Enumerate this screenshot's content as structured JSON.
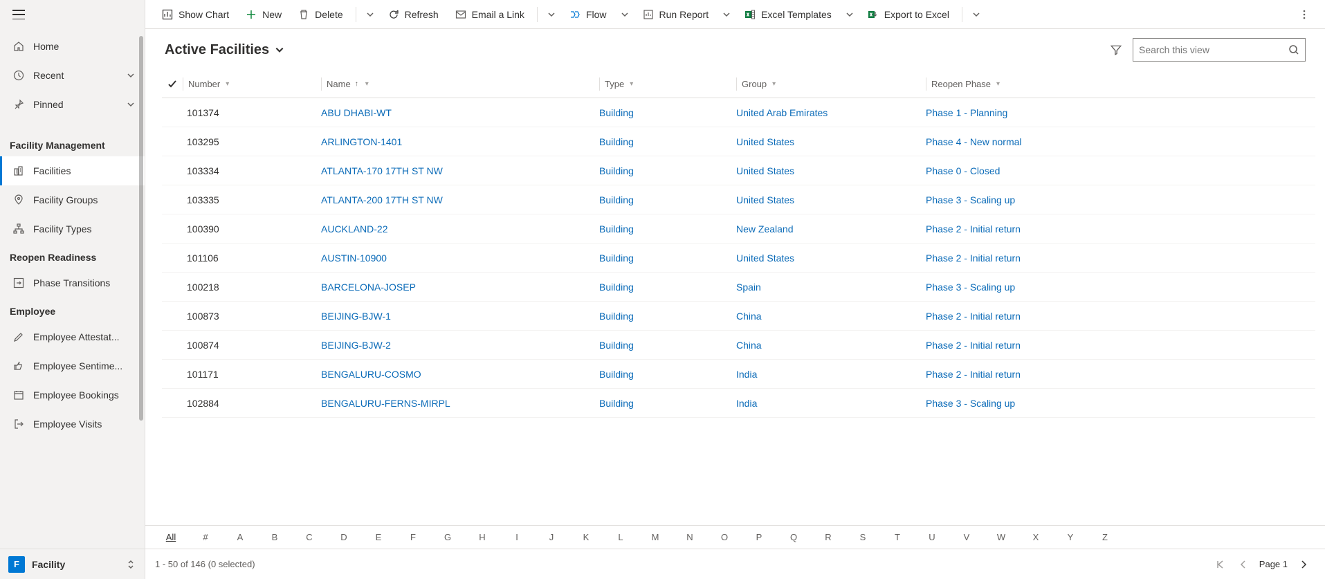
{
  "sidebar": {
    "primary": [
      {
        "label": "Home"
      },
      {
        "label": "Recent"
      },
      {
        "label": "Pinned"
      }
    ],
    "groups": [
      {
        "title": "Facility Management",
        "items": [
          {
            "label": "Facilities",
            "active": true
          },
          {
            "label": "Facility Groups"
          },
          {
            "label": "Facility Types"
          }
        ]
      },
      {
        "title": "Reopen Readiness",
        "items": [
          {
            "label": "Phase Transitions"
          }
        ]
      },
      {
        "title": "Employee",
        "items": [
          {
            "label": "Employee Attestat..."
          },
          {
            "label": "Employee Sentime..."
          },
          {
            "label": "Employee Bookings"
          },
          {
            "label": "Employee Visits"
          }
        ]
      }
    ],
    "bottom": {
      "badge": "F",
      "label": "Facility"
    }
  },
  "commands": {
    "show_chart": "Show Chart",
    "new": "New",
    "delete": "Delete",
    "refresh": "Refresh",
    "email": "Email a Link",
    "flow": "Flow",
    "run_report": "Run Report",
    "excel_templates": "Excel Templates",
    "export_excel": "Export to Excel"
  },
  "view": {
    "title": "Active Facilities",
    "search_placeholder": "Search this view"
  },
  "columns": {
    "number": "Number",
    "name": "Name",
    "type": "Type",
    "group": "Group",
    "phase": "Reopen Phase"
  },
  "rows": [
    {
      "number": "101374",
      "name": "ABU DHABI-WT",
      "type": "Building",
      "group": "United Arab Emirates",
      "phase": "Phase 1 - Planning"
    },
    {
      "number": "103295",
      "name": "ARLINGTON-1401",
      "type": "Building",
      "group": "United States",
      "phase": "Phase 4 - New normal"
    },
    {
      "number": "103334",
      "name": "ATLANTA-170 17TH ST NW",
      "type": "Building",
      "group": "United States",
      "phase": "Phase 0 - Closed"
    },
    {
      "number": "103335",
      "name": "ATLANTA-200 17TH ST NW",
      "type": "Building",
      "group": "United States",
      "phase": "Phase 3 - Scaling up"
    },
    {
      "number": "100390",
      "name": "AUCKLAND-22",
      "type": "Building",
      "group": "New Zealand",
      "phase": "Phase 2 - Initial return"
    },
    {
      "number": "101106",
      "name": "AUSTIN-10900",
      "type": "Building",
      "group": "United States",
      "phase": "Phase 2 - Initial return"
    },
    {
      "number": "100218",
      "name": "BARCELONA-JOSEP",
      "type": "Building",
      "group": "Spain",
      "phase": "Phase 3 - Scaling up"
    },
    {
      "number": "100873",
      "name": "BEIJING-BJW-1",
      "type": "Building",
      "group": "China",
      "phase": "Phase 2 - Initial return"
    },
    {
      "number": "100874",
      "name": "BEIJING-BJW-2",
      "type": "Building",
      "group": "China",
      "phase": "Phase 2 - Initial return"
    },
    {
      "number": "101171",
      "name": "BENGALURU-COSMO",
      "type": "Building",
      "group": "India",
      "phase": "Phase 2 - Initial return"
    },
    {
      "number": "102884",
      "name": "BENGALURU-FERNS-MIRPL",
      "type": "Building",
      "group": "India",
      "phase": "Phase 3 - Scaling up"
    }
  ],
  "alpha": [
    "All",
    "#",
    "A",
    "B",
    "C",
    "D",
    "E",
    "F",
    "G",
    "H",
    "I",
    "J",
    "K",
    "L",
    "M",
    "N",
    "O",
    "P",
    "Q",
    "R",
    "S",
    "T",
    "U",
    "V",
    "W",
    "X",
    "Y",
    "Z"
  ],
  "status": {
    "range": "1 - 50 of 146 (0 selected)",
    "page_label": "Page 1"
  }
}
